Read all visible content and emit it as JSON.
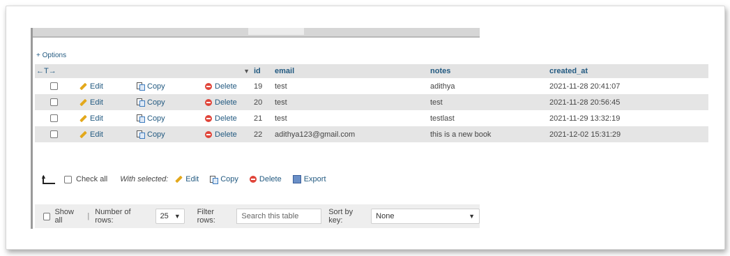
{
  "options_link": "+ Options",
  "column_controls": "←T→",
  "columns": {
    "sort_indicator": "▼",
    "id": "id",
    "email": "email",
    "notes": "notes",
    "created_at": "created_at"
  },
  "row_actions": {
    "edit": "Edit",
    "copy": "Copy",
    "delete": "Delete"
  },
  "rows": [
    {
      "id": "19",
      "email": "test",
      "notes": "adithya",
      "created_at": "2021-11-28 20:41:07"
    },
    {
      "id": "20",
      "email": "test",
      "notes": "test",
      "created_at": "2021-11-28 20:56:45"
    },
    {
      "id": "21",
      "email": "test",
      "notes": "testlast",
      "created_at": "2021-11-29 13:32:19"
    },
    {
      "id": "22",
      "email": "adithya123@gmail.com",
      "notes": "this is a new book",
      "created_at": "2021-12-02 15:31:29"
    }
  ],
  "bulk": {
    "check_all": "Check all",
    "with_selected": "With selected:",
    "edit": "Edit",
    "copy": "Copy",
    "delete": "Delete",
    "export": "Export"
  },
  "filter": {
    "show_all": "Show all",
    "separator": "|",
    "number_of_rows_label": "Number of rows:",
    "number_of_rows_value": "25",
    "filter_rows_label": "Filter rows:",
    "search_placeholder": "Search this table",
    "sort_by_key_label": "Sort by key:",
    "sort_by_key_value": "None"
  },
  "colors": {
    "link": "#235a81",
    "header_bg": "#e3e3e3",
    "row_alt_bg": "#e5e5e5",
    "delete_red": "#e0453a",
    "pencil_orange": "#e3a81b"
  }
}
